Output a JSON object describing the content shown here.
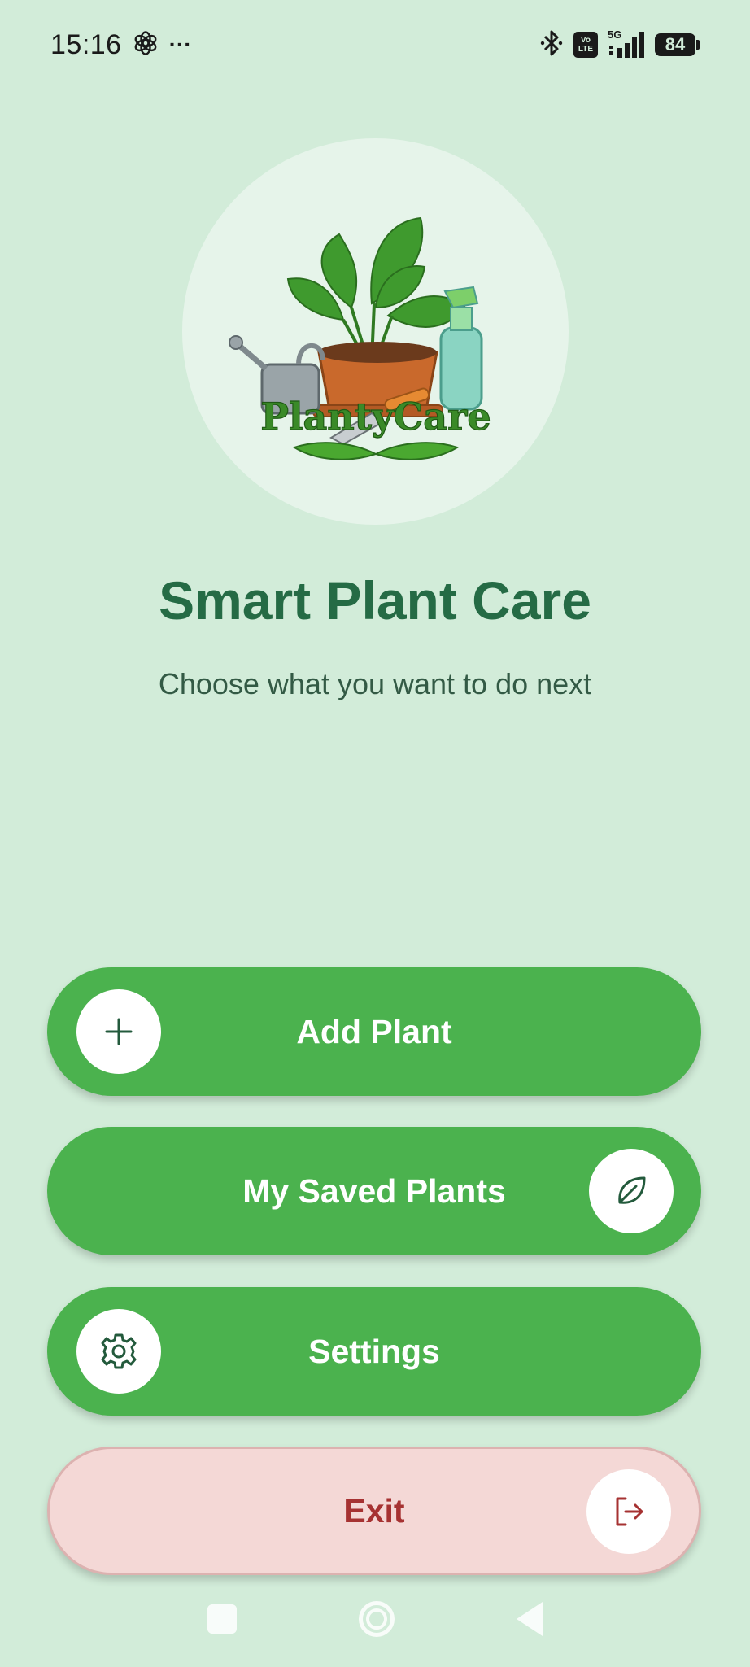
{
  "status_bar": {
    "time": "15:16",
    "more": "···",
    "volte_top": "Vo",
    "volte_bottom": "LTE",
    "network": "5G",
    "battery": "84"
  },
  "logo": {
    "brand_text": "PlantyCare"
  },
  "main": {
    "title": "Smart Plant Care",
    "subtitle": "Choose what you want to do next"
  },
  "buttons": {
    "add_plant": "Add Plant",
    "saved_plants": "My Saved Plants",
    "settings": "Settings",
    "exit": "Exit"
  },
  "colors": {
    "background": "#d2ecd9",
    "primary_button": "#4bb24e",
    "title": "#256b45",
    "exit_bg": "#f4d8d6",
    "exit_text": "#a63232"
  },
  "icons": {
    "add": "plus-icon",
    "saved": "leaf-icon",
    "settings": "gear-icon",
    "exit": "logout-icon"
  }
}
